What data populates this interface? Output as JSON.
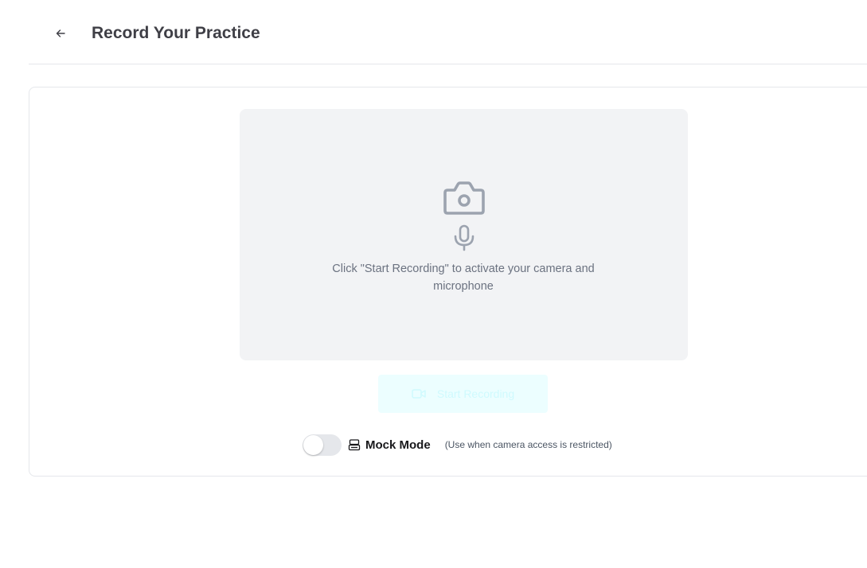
{
  "header": {
    "title": "Record Your Practice",
    "back_icon": "arrow-left-icon"
  },
  "preview": {
    "camera_icon": "camera-icon",
    "mic_icon": "microphone-icon",
    "hint": "Click \"Start Recording\" to activate your camera and microphone"
  },
  "controls": {
    "start_label": "Start Recording",
    "start_icon": "video-camera-icon",
    "start_enabled": false
  },
  "mock_mode": {
    "label": "Mock Mode",
    "note": "(Use when camera access is restricted)",
    "enabled": false,
    "icon": "robot-icon"
  },
  "colors": {
    "accent_disabled_bg": "#ecfeff",
    "accent_disabled_text": "#cffafe",
    "preview_bg": "#f2f3f5",
    "icon_gray": "#9ca3af"
  }
}
